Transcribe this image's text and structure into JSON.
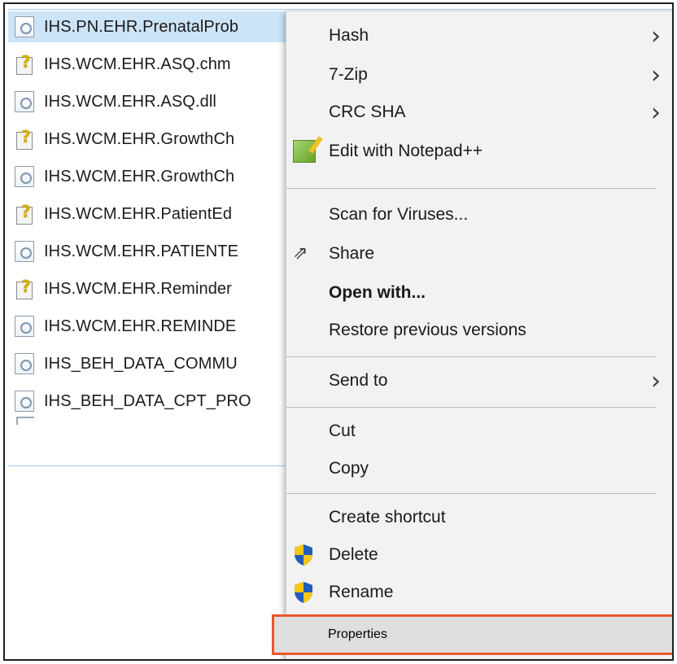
{
  "files": [
    {
      "name": "IHS.PN.EHR.PrenatalProb",
      "icon": "dll-icon",
      "selected": true
    },
    {
      "name": "IHS.WCM.EHR.ASQ.chm",
      "icon": "chm-help-icon"
    },
    {
      "name": "IHS.WCM.EHR.ASQ.dll",
      "icon": "dll-icon"
    },
    {
      "name": "IHS.WCM.EHR.GrowthCh",
      "icon": "chm-help-icon"
    },
    {
      "name": "IHS.WCM.EHR.GrowthCh",
      "icon": "dll-icon"
    },
    {
      "name": "IHS.WCM.EHR.PatientEd",
      "icon": "chm-help-icon"
    },
    {
      "name": "IHS.WCM.EHR.PATIENTE",
      "icon": "dll-icon"
    },
    {
      "name": "IHS.WCM.EHR.Reminder",
      "icon": "chm-help-icon"
    },
    {
      "name": "IHS.WCM.EHR.REMINDE",
      "icon": "dll-icon"
    },
    {
      "name": "IHS_BEH_DATA_COMMU",
      "icon": "dll-icon"
    },
    {
      "name": "IHS_BEH_DATA_CPT_PRO",
      "icon": "dll-icon"
    }
  ],
  "context_menu": {
    "items": [
      {
        "label": "Hash",
        "submenu": true
      },
      {
        "label": "7-Zip",
        "submenu": true
      },
      {
        "label": "CRC SHA",
        "submenu": true
      },
      {
        "label": "Edit with Notepad++",
        "icon": "notepad-plus-plus-icon"
      },
      {
        "label": "Scan for Viruses..."
      },
      {
        "label": "Share",
        "icon": "share-icon"
      },
      {
        "label": "Open with...",
        "bold": true
      },
      {
        "label": "Restore previous versions"
      },
      {
        "label": "Send to",
        "submenu": true
      },
      {
        "label": "Cut"
      },
      {
        "label": "Copy"
      },
      {
        "label": "Create shortcut"
      },
      {
        "label": "Delete",
        "icon": "uac-shield-icon"
      },
      {
        "label": "Rename",
        "icon": "uac-shield-icon"
      },
      {
        "label": "Properties",
        "highlighted": true
      }
    ],
    "submenu_arrow": "›"
  },
  "colors": {
    "selection": "#cce4f7",
    "menu_bg": "#f2f2f2",
    "highlight_border": "#e8572e"
  }
}
